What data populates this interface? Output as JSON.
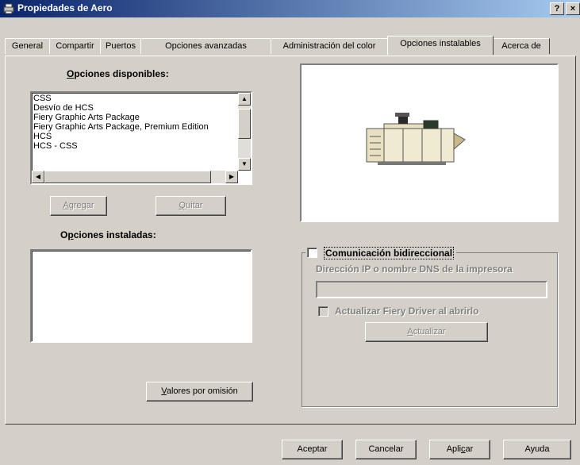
{
  "window": {
    "title": "Propiedades de Aero",
    "help_label": "?",
    "close_label": "×"
  },
  "tabs": [
    {
      "label": "General"
    },
    {
      "label": "Compartir"
    },
    {
      "label": "Puertos"
    },
    {
      "label": "Opciones avanzadas"
    },
    {
      "label": "Administración del color"
    },
    {
      "label": "Opciones instalables",
      "active": true
    },
    {
      "label": "Acerca de"
    }
  ],
  "available": {
    "heading_accel": "O",
    "heading_rest": "pciones disponibles:",
    "items": [
      "CSS",
      "Desvío de HCS",
      "Fiery Graphic Arts Package",
      "Fiery Graphic Arts Package, Premium Edition",
      "HCS",
      "HCS - CSS"
    ],
    "add_accel": "A",
    "add_rest": "gregar",
    "remove_accel": "Q",
    "remove_rest": "uitar"
  },
  "installed": {
    "heading_accel": "p",
    "heading_pre": "O",
    "heading_rest": "ciones instaladas:",
    "items": []
  },
  "defaults_button": {
    "accel": "V",
    "rest": "alores por omisión"
  },
  "bidirectional": {
    "checked": false,
    "label": "Comunicación bidireccional",
    "ip_label": "Dirección IP o nombre DNS de la impresora",
    "ip_value": "",
    "update_on_open_label": "Actualizar Fiery Driver al abrirlo",
    "update_on_open_checked": false,
    "update_accel": "A",
    "update_rest": "ctualizar"
  },
  "footer": {
    "ok": "Aceptar",
    "cancel": "Cancelar",
    "apply_pre": "Apli",
    "apply_accel": "c",
    "apply_post": "ar",
    "help": "Ayuda"
  }
}
